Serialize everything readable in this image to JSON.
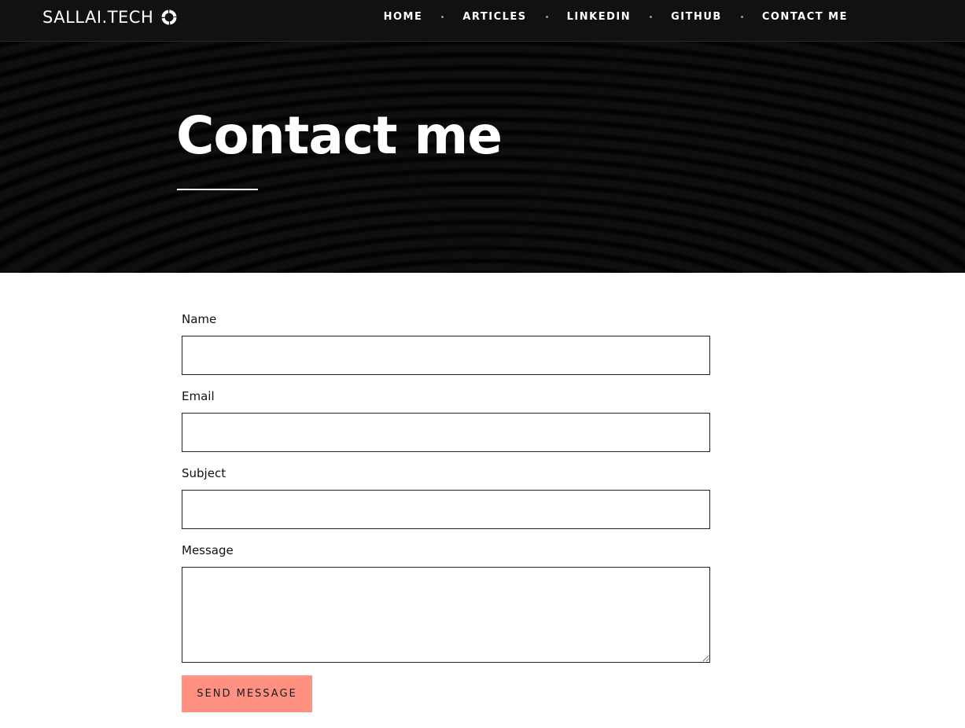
{
  "header": {
    "brand_text": "SALLAI.TECH",
    "brand_icon": "circle-arrow-icon",
    "nav_items": [
      {
        "label": "HOME"
      },
      {
        "label": "ARTICLES"
      },
      {
        "label": "LINKEDIN"
      },
      {
        "label": "GITHUB"
      },
      {
        "label": "CONTACT ME"
      }
    ]
  },
  "hero": {
    "title": "Contact me"
  },
  "form": {
    "name_label": "Name",
    "name_value": "",
    "email_label": "Email",
    "email_value": "",
    "subject_label": "Subject",
    "subject_value": "",
    "message_label": "Message",
    "message_value": "",
    "submit_label": "SEND MESSAGE"
  },
  "colors": {
    "navbar_background": "#111111",
    "hero_background": "#050505",
    "button_accent": "#ff9183",
    "input_border": "#222222"
  }
}
